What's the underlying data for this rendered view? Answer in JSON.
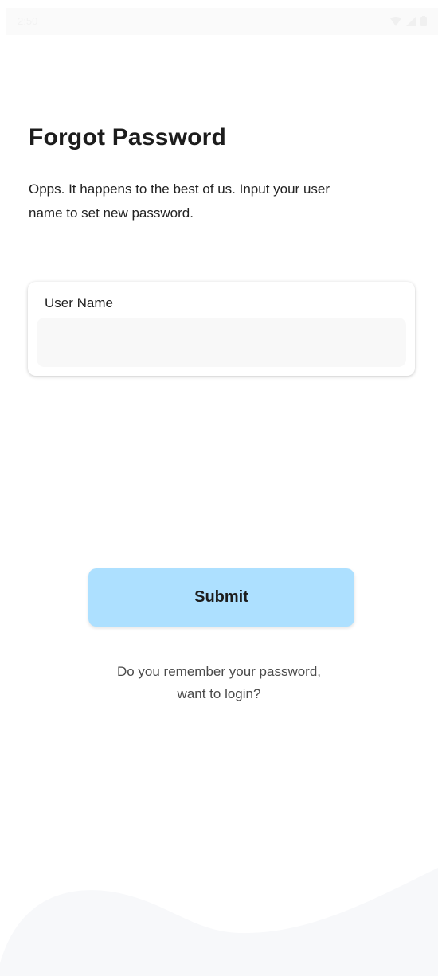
{
  "status_bar": {
    "time": "2:50",
    "icons": [
      "wifi-icon",
      "signal-icon",
      "battery-icon"
    ]
  },
  "page": {
    "title": "Forgot Password",
    "subtitle": "Opps. It happens to the best of us. Input your user name to set new password."
  },
  "form": {
    "username_label": "User Name",
    "username_value": "",
    "username_placeholder": ""
  },
  "actions": {
    "submit_label": "Submit",
    "login_prompt_text": "Do you remember your password,",
    "login_link_text": "want to login?"
  },
  "colors": {
    "accent": "#ade0ff",
    "input_background": "#f8f8f8",
    "wave": "#f7f8fa"
  }
}
